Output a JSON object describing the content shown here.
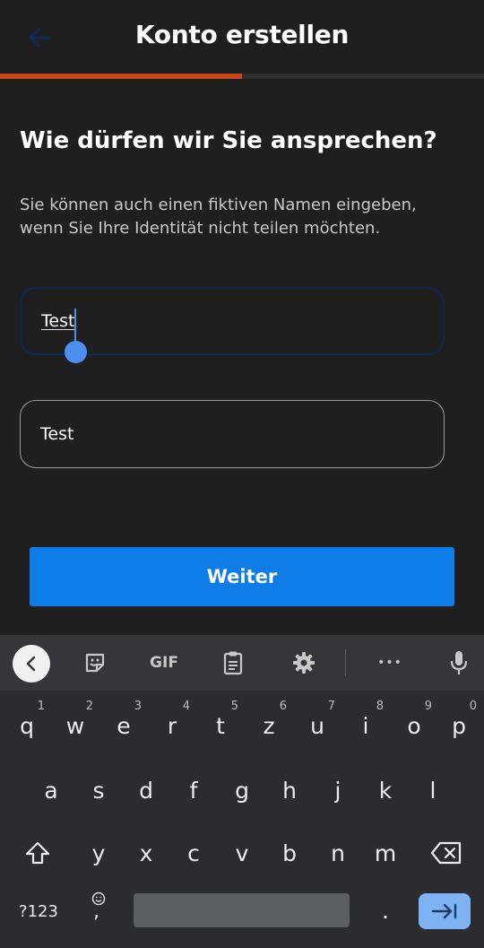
{
  "header": {
    "title": "Konto erstellen",
    "back_icon": "arrow-left-icon"
  },
  "progress": {
    "fraction": 0.5,
    "color": "#c8481e"
  },
  "question": "Wie dürfen wir Sie ansprechen?",
  "helper_line1": "Sie können auch einen fiktiven Namen eingeben,",
  "helper_line2": "wenn Sie Ihre Identität nicht teilen möchten.",
  "first_name": {
    "value": "Test"
  },
  "last_name": {
    "value": "Test"
  },
  "next_button": {
    "label": "Weiter",
    "color": "#0f7de8"
  },
  "keyboard": {
    "toolbar": {
      "gif_label": "GIF",
      "more_label": "•••"
    },
    "row1": [
      {
        "key": "q",
        "hint": "1"
      },
      {
        "key": "w",
        "hint": "2"
      },
      {
        "key": "e",
        "hint": "3"
      },
      {
        "key": "r",
        "hint": "4"
      },
      {
        "key": "t",
        "hint": "5"
      },
      {
        "key": "z",
        "hint": "6"
      },
      {
        "key": "u",
        "hint": "7"
      },
      {
        "key": "i",
        "hint": "8"
      },
      {
        "key": "o",
        "hint": "9"
      },
      {
        "key": "p",
        "hint": "0"
      }
    ],
    "row2": [
      "a",
      "s",
      "d",
      "f",
      "g",
      "h",
      "j",
      "k",
      "l"
    ],
    "row3": [
      "y",
      "x",
      "c",
      "v",
      "b",
      "n",
      "m"
    ],
    "symbols_label": "?123",
    "comma": ",",
    "period": "."
  }
}
